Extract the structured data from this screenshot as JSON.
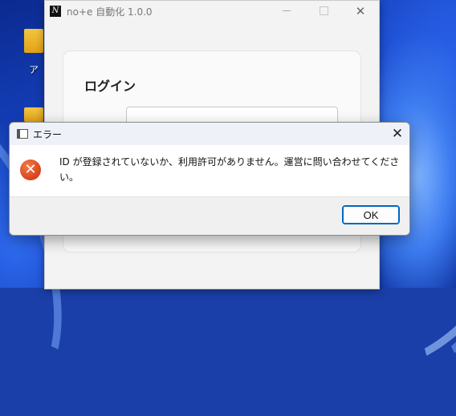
{
  "app_window": {
    "title": "no+e 自動化 1.0.0",
    "logo_glyph": "N",
    "close_glyph": "✕"
  },
  "login": {
    "heading": "ログイン"
  },
  "desktop": {
    "icon_label": "ア"
  },
  "dialog": {
    "title": "エラー",
    "close_glyph": "✕",
    "icon_glyph": "✕",
    "message": "ID が登録されていないか、利用許可がありません。運営に問い合わせてください。",
    "ok_label": "OK"
  },
  "colors": {
    "accent": "#0067c0",
    "error_icon": "#d8431d"
  }
}
